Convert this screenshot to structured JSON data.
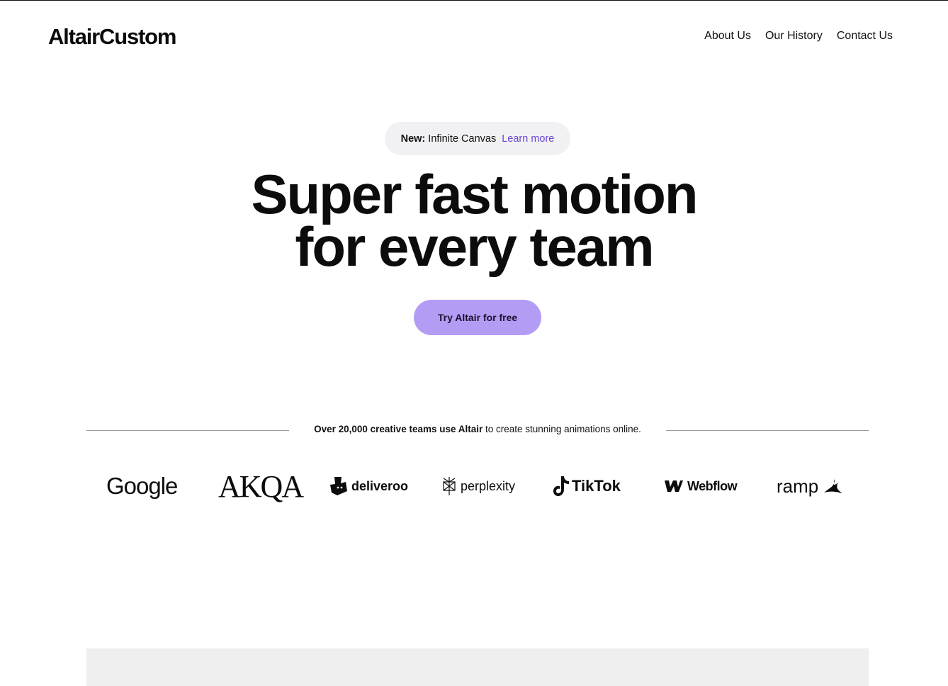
{
  "header": {
    "logo": "AltairCustom",
    "nav": [
      {
        "label": "About Us"
      },
      {
        "label": "Our History"
      },
      {
        "label": "Contact Us"
      }
    ]
  },
  "announcement": {
    "tag": "New:",
    "text": "Infinite Canvas",
    "link": "Learn more"
  },
  "hero": {
    "line1": "Super fast motion",
    "line2": "for every team",
    "cta": "Try Altair for free"
  },
  "trust": {
    "strong": "Over 20,000 creative teams use Altair",
    "rest": " to create stunning animations online."
  },
  "brands": {
    "google": "Google",
    "akqa": "AKQA",
    "deliveroo": "deliveroo",
    "perplexity": "perplexity",
    "tiktok": "TikTok",
    "webflow": "Webflow",
    "ramp": "ramp"
  },
  "colors": {
    "accent": "#b39cf3",
    "link": "#6a46d6",
    "pill_bg": "#f1f1f3",
    "panel_bg": "#efefef"
  }
}
